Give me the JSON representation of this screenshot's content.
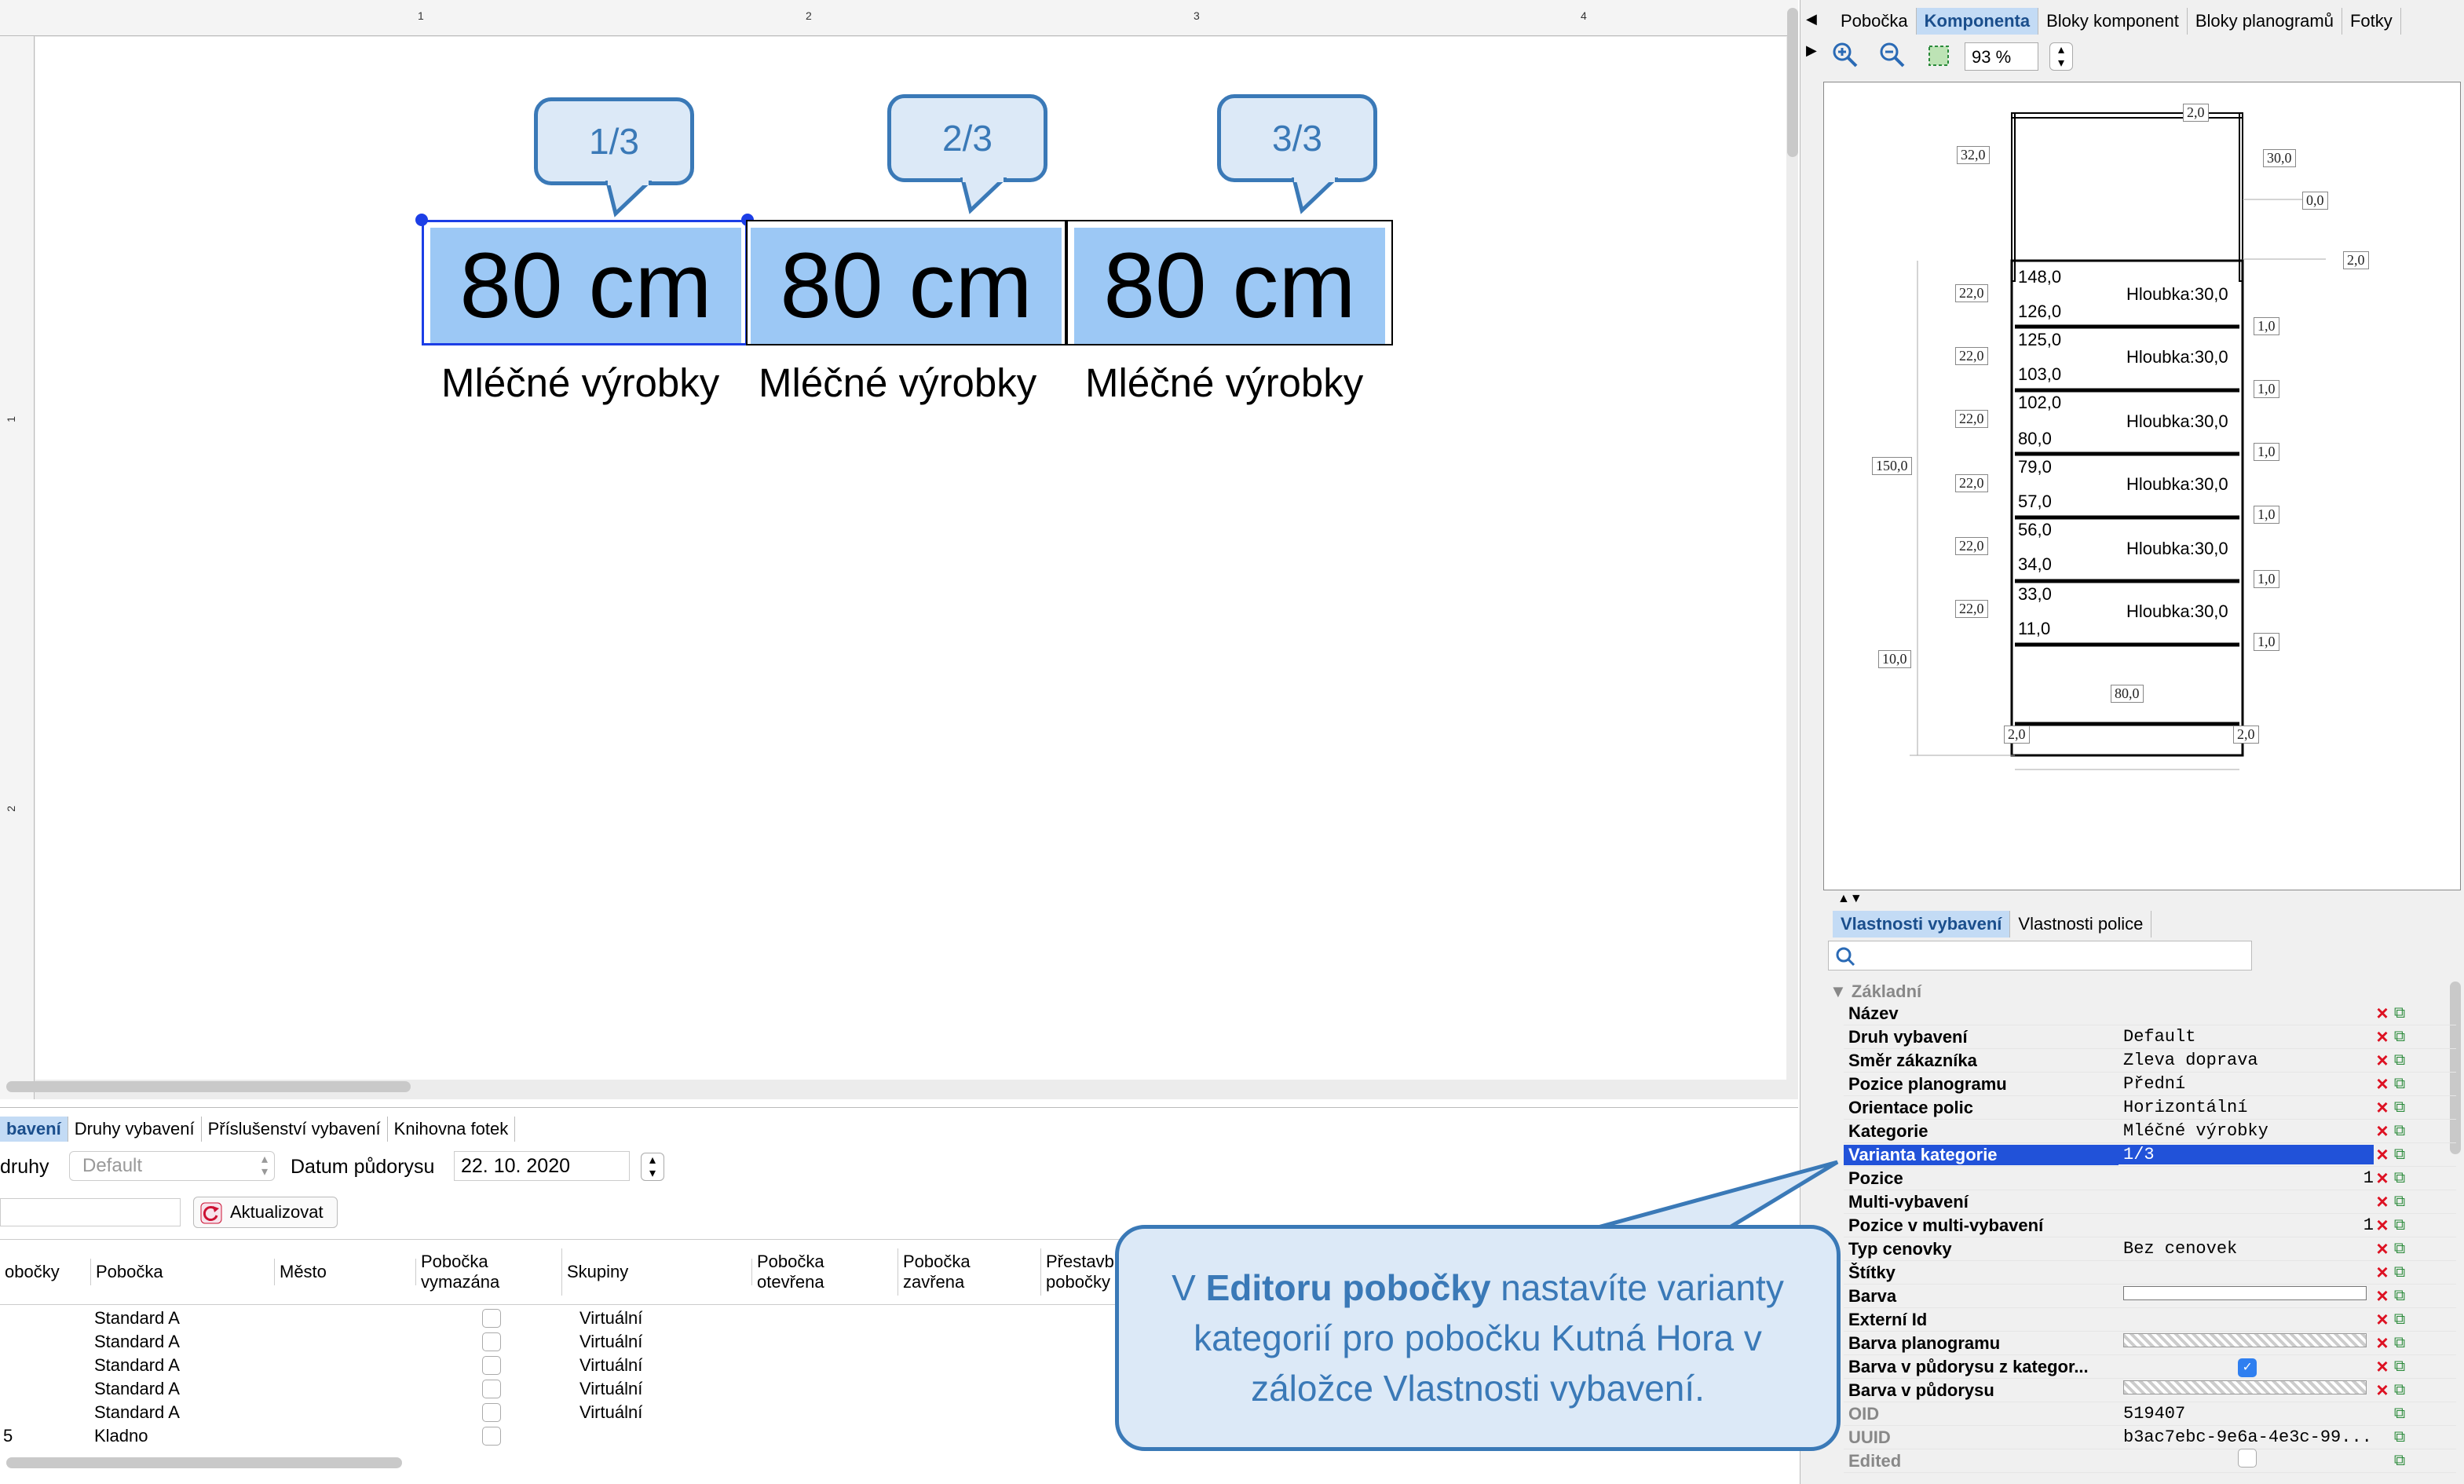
{
  "canvas": {
    "ruler_top_labels": [
      "1",
      "2",
      "3",
      "4"
    ],
    "ruler_left_labels": [
      "1",
      "2"
    ],
    "shelves": [
      {
        "size": "80 cm",
        "category": "Mléčné výrobky",
        "callout": "1/3"
      },
      {
        "size": "80 cm",
        "category": "Mléčné výrobky",
        "callout": "2/3"
      },
      {
        "size": "80 cm",
        "category": "Mléčné výrobky",
        "callout": "3/3"
      }
    ]
  },
  "right_tabs": [
    "Pobočka",
    "Komponenta",
    "Bloky komponent",
    "Bloky planogramů",
    "Fotky"
  ],
  "zoom": "93 %",
  "preview": {
    "top_dims": [
      "2,0",
      "32,0",
      "30,0",
      "0,0"
    ],
    "height_total": "150,0",
    "base": "10,0",
    "width": "80,0",
    "feet": [
      "2,0",
      "2,0"
    ],
    "top2": "2,0",
    "shelves": [
      {
        "top": "148,0",
        "bottom": "126,0",
        "depth": "Hloubka:30,0",
        "left": "22,0",
        "right": "1,0"
      },
      {
        "top": "125,0",
        "bottom": "103,0",
        "depth": "Hloubka:30,0",
        "left": "22,0",
        "right": "1,0"
      },
      {
        "top": "102,0",
        "bottom": "80,0",
        "depth": "Hloubka:30,0",
        "left": "22,0",
        "right": "1,0"
      },
      {
        "top": "79,0",
        "bottom": "57,0",
        "depth": "Hloubka:30,0",
        "left": "22,0",
        "right": "1,0"
      },
      {
        "top": "56,0",
        "bottom": "34,0",
        "depth": "Hloubka:30,0",
        "left": "22,0",
        "right": "1,0"
      },
      {
        "top": "33,0",
        "bottom": "11,0",
        "depth": "Hloubka:30,0",
        "left": "22,0",
        "right": "1,0"
      }
    ]
  },
  "prop_tabs": [
    "Vlastnosti vybavení",
    "Vlastnosti police"
  ],
  "group": "Základní",
  "properties": [
    {
      "name": "Název",
      "value": ""
    },
    {
      "name": "Druh vybavení",
      "value": "Default"
    },
    {
      "name": "Směr zákazníka",
      "value": "Zleva doprava"
    },
    {
      "name": "Pozice planogramu",
      "value": "Přední"
    },
    {
      "name": "Orientace polic",
      "value": "Horizontální"
    },
    {
      "name": "Kategorie",
      "value": "Mléčné výrobky"
    },
    {
      "name": "Varianta kategorie",
      "value": "1/3"
    },
    {
      "name": "Pozice",
      "value": "1"
    },
    {
      "name": "Multi-vybavení",
      "value": ""
    },
    {
      "name": "Pozice v multi-vybavení",
      "value": "1"
    },
    {
      "name": "Typ cenovky",
      "value": "Bez cenovek"
    },
    {
      "name": "Štítky",
      "value": ""
    },
    {
      "name": "Barva",
      "value": ""
    },
    {
      "name": "Externí Id",
      "value": ""
    },
    {
      "name": "Barva planogramu",
      "value": ""
    },
    {
      "name": "Barva v půdorysu z kategor...",
      "value": ""
    },
    {
      "name": "Barva v půdorysu",
      "value": ""
    },
    {
      "name": "OID",
      "value": "519407"
    },
    {
      "name": "UUID",
      "value": "b3ac7ebc-9e6a-4e3c-99..."
    },
    {
      "name": "Edited",
      "value": ""
    }
  ],
  "bottom": {
    "tabs": [
      "bavení",
      "Druhy vybavení",
      "Příslušenství vybavení",
      "Knihovna fotek"
    ],
    "druhy_label": "druhy",
    "druhy_value": "Default",
    "datum_label": "Datum půdorysu",
    "datum_value": "22. 10. 2020",
    "refresh_button": "Aktualizovat",
    "headers": [
      "obočky",
      "Pobočka",
      "Město",
      "Pobočka\nvymazána",
      "Skupiny",
      "Pobočka\notevřena",
      "Pobočka zavřena",
      "Přestavb\npobočky"
    ],
    "rows": [
      {
        "c0": "",
        "branch": "Standard A",
        "group": "Virtuální"
      },
      {
        "c0": "",
        "branch": "Standard A",
        "group": "Virtuální"
      },
      {
        "c0": "",
        "branch": "Standard A",
        "group": "Virtuální"
      },
      {
        "c0": "",
        "branch": "Standard A",
        "group": "Virtuální"
      },
      {
        "c0": "",
        "branch": "Standard A",
        "group": "Virtuální"
      },
      {
        "c0": "5",
        "branch": "Kladno",
        "group": ""
      }
    ]
  },
  "annotation": {
    "pre": "V ",
    "bold": "Editoru pobočky",
    "post": " nastavíte varianty kategorií pro pobočku Kutná Hora v záložce Vlastnosti vybavení."
  }
}
